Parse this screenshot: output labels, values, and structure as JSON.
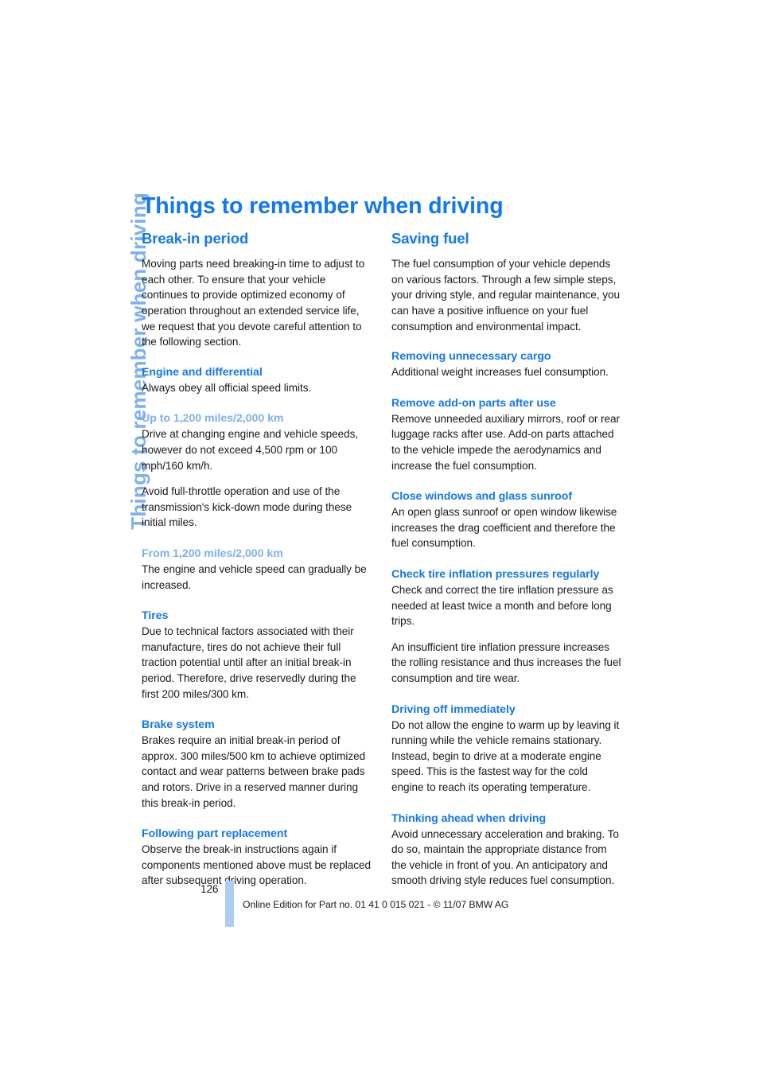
{
  "document": {
    "side_tab": "Things to remember when driving",
    "chapter_title": "Things to remember when driving"
  },
  "left_column": {
    "section_title": "Break-in period",
    "intro": "Moving parts need breaking-in time to adjust to each other. To ensure that your vehicle continues to provide optimized economy of operation throughout an extended service life, we request that you devote careful attention to the following section.",
    "sub1": {
      "heading": "Engine and differential",
      "body": "Always obey all official speed limits."
    },
    "subsub1": {
      "heading": "Up to 1,200 miles/2,000 km",
      "body1": "Drive at changing engine and vehicle speeds, however do not exceed 4,500 rpm or 100 mph/160 km/h.",
      "body2": "Avoid full-throttle operation and use of the transmission's kick-down mode during these initial miles."
    },
    "subsub2": {
      "heading": "From 1,200 miles/2,000 km",
      "body": "The engine and vehicle speed can gradually be increased."
    },
    "sub2": {
      "heading": "Tires",
      "body": "Due to technical factors associated with their manufacture, tires do not achieve their full traction potential until after an initial break-in period. Therefore, drive reservedly during the first 200 miles/300 km."
    },
    "sub3": {
      "heading": "Brake system",
      "body": "Brakes require an initial break-in period of approx. 300 miles/500 km to achieve optimized contact and wear patterns between brake pads and rotors. Drive in a reserved manner during this break-in period."
    },
    "sub4": {
      "heading": "Following part replacement",
      "body": "Observe the break-in instructions again if components mentioned above must be replaced after subsequent driving operation."
    }
  },
  "right_column": {
    "section_title": "Saving fuel",
    "intro": "The fuel consumption of your vehicle depends on various factors. Through a few simple steps, your driving style, and regular maintenance, you can have a positive influence on your fuel consumption and environmental impact.",
    "sub1": {
      "heading": "Removing unnecessary cargo",
      "body": "Additional weight increases fuel consumption."
    },
    "sub2": {
      "heading": "Remove add-on parts after use",
      "body": "Remove unneeded auxiliary mirrors, roof or rear luggage racks after use. Add-on parts attached to the vehicle impede the aerodynamics and increase the fuel consumption."
    },
    "sub3": {
      "heading": "Close windows and glass sunroof",
      "body": "An open glass sunroof or open window likewise increases the drag coefficient and therefore the fuel consumption."
    },
    "sub4": {
      "heading": "Check tire inflation pressures regularly",
      "body1": "Check and correct the tire inflation pressure as needed at least twice a month and before long trips.",
      "body2": "An insufficient tire inflation pressure increases the rolling resistance and thus increases the fuel consumption and tire wear."
    },
    "sub5": {
      "heading": "Driving off immediately",
      "body": "Do not allow the engine to warm up by leaving it running while the vehicle remains stationary. Instead, begin to drive at a moderate engine speed. This is the fastest way for the cold engine to reach its operating temperature."
    },
    "sub6": {
      "heading": "Thinking ahead when driving",
      "body": "Avoid unnecessary acceleration and braking. To do so, maintain the appropriate distance from the vehicle in front of you. An anticipatory and smooth driving style reduces fuel consumption."
    }
  },
  "footer": {
    "page_number": "126",
    "note": "Online Edition for Part no. 01 41 0 015 021 - © 11/07 BMW AG"
  },
  "colors": {
    "heading_blue": "#1277f0",
    "light_blue": "#7eb0ef",
    "bar_blue": "#aecdf2",
    "body_text": "#1a1a1a",
    "background": "#ffffff"
  }
}
